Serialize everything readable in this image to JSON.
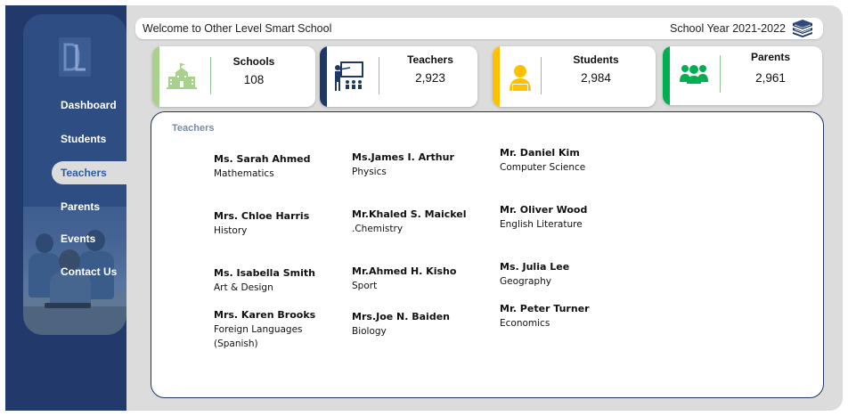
{
  "header": {
    "welcome": "Welcome to Other Level Smart School",
    "school_year": "School Year 2021-2022"
  },
  "sidebar": {
    "logo_icon": "dl-logo-icon",
    "items": [
      {
        "label": "Dashboard",
        "active": false
      },
      {
        "label": "Students",
        "active": false
      },
      {
        "label": "Teachers",
        "active": true
      },
      {
        "label": "Parents",
        "active": false
      },
      {
        "label": "Events",
        "active": false
      },
      {
        "label": "Contact Us",
        "active": false
      }
    ]
  },
  "stats": [
    {
      "label": "Schools",
      "value": "108",
      "icon": "school-icon",
      "accent": "#a9d18e"
    },
    {
      "label": "Teachers",
      "value": "2,923",
      "icon": "teacher-board-icon",
      "accent": "#1f3864"
    },
    {
      "label": "Students",
      "value": "2,984",
      "icon": "student-icon",
      "accent": "#ffc000"
    },
    {
      "label": "Parents",
      "value": "2,961",
      "icon": "parents-icon",
      "accent": "#00b050"
    }
  ],
  "teachers_panel": {
    "title": "Teachers",
    "teachers": [
      {
        "name": "Ms. Sarah Ahmed",
        "subject": "Mathematics"
      },
      {
        "name": "Ms.James I. Arthur",
        "subject": "Physics"
      },
      {
        "name": "Mr. Daniel Kim",
        "subject": "Computer Science"
      },
      {
        "name": "Mrs. Chloe Harris",
        "subject": "History"
      },
      {
        "name": "Mr.Khaled S. Maickel",
        "subject": ".Chemistry"
      },
      {
        "name": "Mr. Oliver Wood",
        "subject": "English Literature"
      },
      {
        "name": "Ms. Isabella Smith",
        "subject": "Art & Design"
      },
      {
        "name": "Mr.Ahmed H. Kisho",
        "subject": "Sport"
      },
      {
        "name": "Ms. Julia Lee",
        "subject": "Geography"
      },
      {
        "name": "Mrs. Karen Brooks",
        "subject": "Foreign Languages (Spanish)"
      },
      {
        "name": "Mrs.Joe N. Baiden",
        "subject": "Biology"
      },
      {
        "name": "Mr. Peter Turner",
        "subject": "Economics"
      }
    ]
  }
}
